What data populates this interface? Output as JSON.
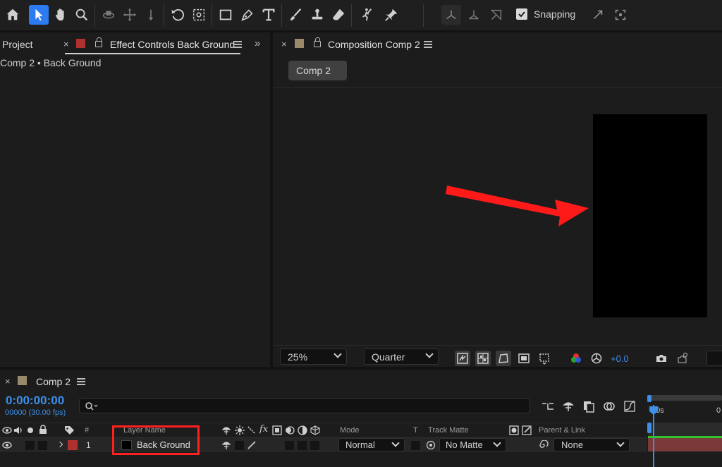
{
  "toolbar": {
    "tools": [
      "home-icon",
      "selection-tool-icon",
      "hand-tool-icon",
      "zoom-tool-icon",
      "orbit-camera-icon",
      "pan-camera-icon",
      "dolly-camera-icon",
      "rotation-tool-icon",
      "pan-behind-icon",
      "rectangle-tool-icon",
      "pen-tool-icon",
      "type-tool-icon",
      "brush-tool-icon",
      "clone-stamp-icon",
      "eraser-tool-icon",
      "roto-brush-icon",
      "puppet-pin-icon"
    ],
    "snapping_label": "Snapping",
    "snapping_checked": true
  },
  "left_panel": {
    "tab_project": "Project",
    "tab_effect_controls": "Effect Controls Back Ground",
    "breadcrumb": "Comp 2 • Back Ground",
    "effect_swatch_color": "#b03030"
  },
  "composition_panel": {
    "tab_label": "Composition Comp 2",
    "comp_tab_chip": "Comp 2",
    "swatch_color": "#9a8a6a",
    "zoom_value": "25%",
    "resolution_value": "Quarter",
    "exposure_value": "+0.0",
    "canvas_color": "#000000",
    "arrow_color": "#ff1a1a"
  },
  "timeline": {
    "tab_label": "Comp 2",
    "timecode": "0:00:00:00",
    "frames_fps": "00000 (30.00 fps)",
    "search_placeholder": "",
    "columns": {
      "number": "#",
      "layer_name": "Layer Name",
      "mode": "Mode",
      "t": "T",
      "track_matte": "Track Matte",
      "parent_link": "Parent & Link"
    },
    "ruler_label": "00s",
    "ruler_end": "0",
    "layers": [
      {
        "number": "1",
        "name": "Back Ground",
        "label_color": "#b03030",
        "mode": "Normal",
        "track_matte": "No Matte",
        "parent": "None"
      }
    ],
    "highlight_color": "#ff2020",
    "timecode_color": "#3d8fe8"
  }
}
